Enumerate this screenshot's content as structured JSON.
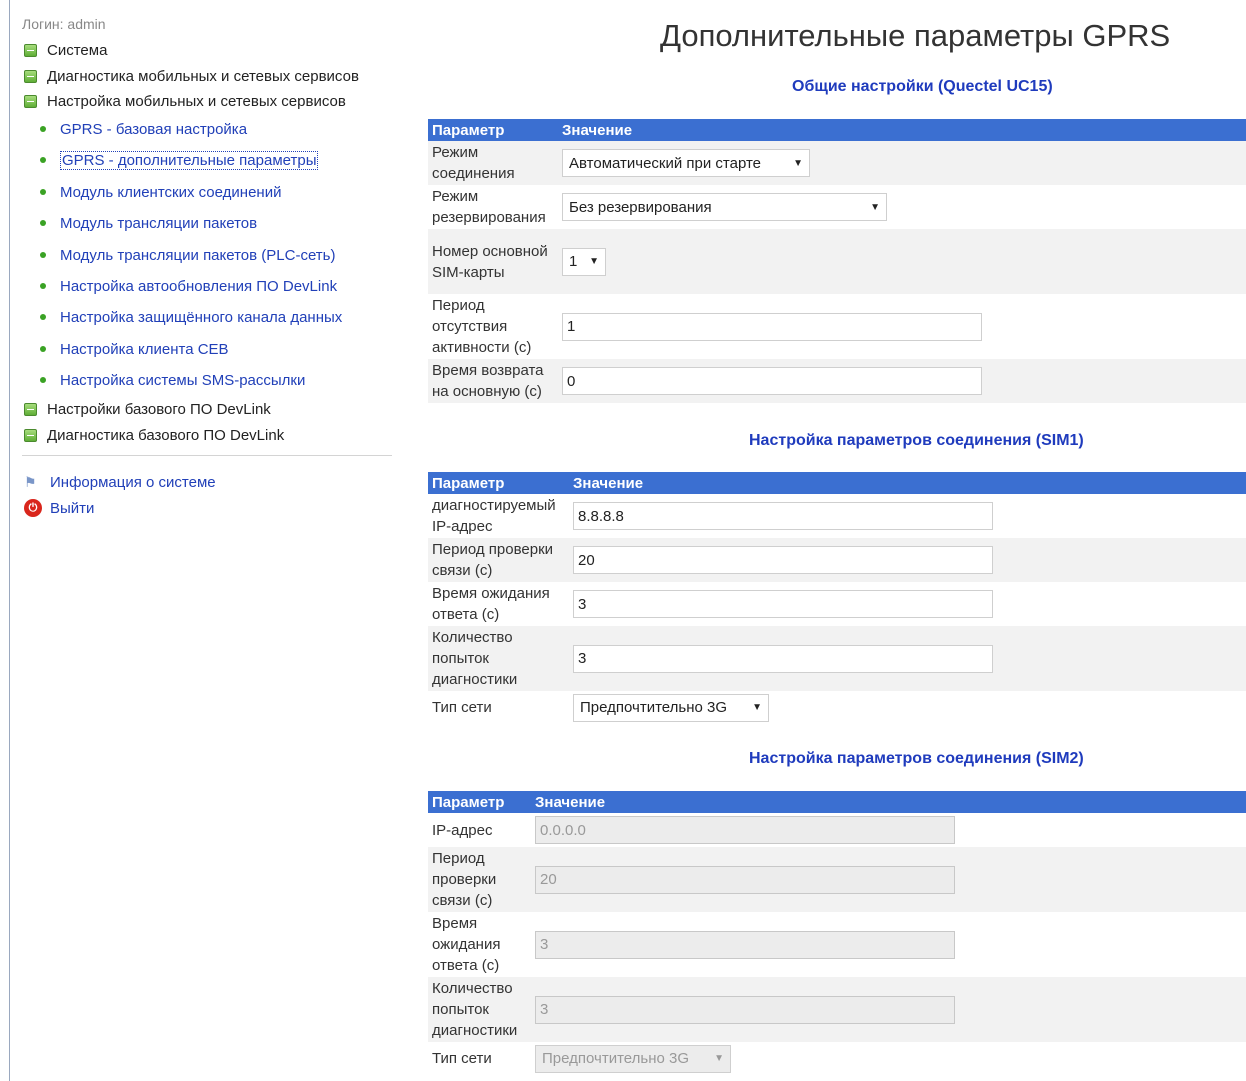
{
  "sidebar": {
    "login_label": "Логин: admin",
    "top_items": [
      "Система",
      "Диагностика мобильных и сетевых сервисов",
      "Настройка мобильных и сетевых сервисов"
    ],
    "sub_items": [
      "GPRS - базовая настройка",
      "GPRS - дополнительные параметры",
      "Модуль клиентских соединений",
      "Модуль трансляции пакетов",
      "Модуль трансляции пакетов (PLC-сеть)",
      "Настройка автообновления ПО DevLink",
      "Настройка защищённого канала данных",
      "Настройка клиента CEB",
      "Настройка системы SMS-рассылки"
    ],
    "bottom_items": [
      "Настройки базового ПО DevLink",
      "Диагностика базового ПО DevLink"
    ],
    "info_link": "Информация о системе",
    "logout_link": "Выйти"
  },
  "page": {
    "title": "Дополнительные параметры GPRS"
  },
  "general": {
    "title": "Общие настройки (Quectel UC15)",
    "col_param": "Параметр",
    "col_value": "Значение",
    "rows": {
      "mode_label": "Режим соединения",
      "mode_value": "Автоматический при старте",
      "backup_label": "Режим резервирования",
      "backup_value": "Без резервирования",
      "sim_label": "Номер основной SIM-карты",
      "sim_value": "1",
      "idle_label": "Период отсутствия активности (с)",
      "idle_value": "1",
      "return_label": "Время возврата на основную (с)",
      "return_value": "0"
    }
  },
  "sim1": {
    "title": "Настройка параметров соединения (SIM1)",
    "col_param": "Параметр",
    "col_value": "Значение",
    "rows": {
      "ip_label": "диагностируемый IP-адрес",
      "ip_value": "8.8.8.8",
      "period_label": "Период проверки связи (с)",
      "period_value": "20",
      "timeout_label": "Время ожидания ответа (с)",
      "timeout_value": "3",
      "attempts_label": "Количество попыток диагностики",
      "attempts_value": "3",
      "net_label": "Тип сети",
      "net_value": "Предпочтительно 3G"
    }
  },
  "sim2": {
    "title": "Настройка параметров соединения (SIM2)",
    "col_param": "Параметр",
    "col_value": "Значение",
    "rows": {
      "ip_label": "IP-адрес",
      "ip_value": "0.0.0.0",
      "period_label": "Период проверки связи (с)",
      "period_value": "20",
      "timeout_label": "Время ожидания ответа (с)",
      "timeout_value": "3",
      "attempts_label": "Количество попыток диагностики",
      "attempts_value": "3",
      "net_label": "Тип сети",
      "net_value": "Предпочтительно 3G"
    }
  },
  "colors": {
    "header_bar": "#3b6fd1",
    "link": "#2140b8",
    "section_title": "#1f3bbd",
    "row_alt": "#f2f2f2"
  }
}
